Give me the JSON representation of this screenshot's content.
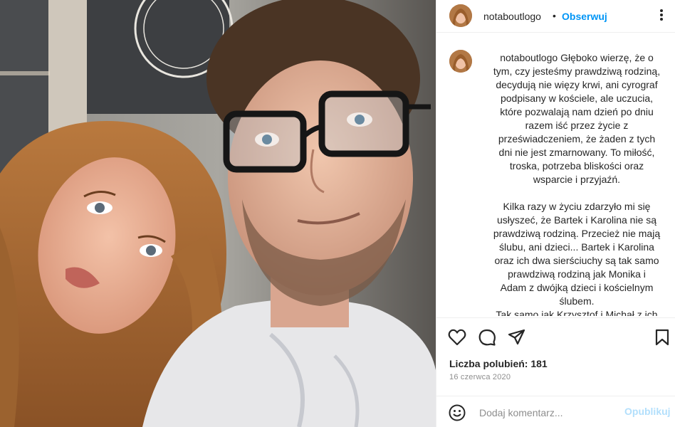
{
  "post": {
    "username": "notaboutlogo",
    "separator": "•",
    "follow_label": "Obserwuj",
    "caption_username": "notaboutlogo",
    "caption_lines": [
      "Głęboko wierzę, że o",
      "tym, czy jesteśmy prawdziwą rodziną,",
      "decydują nie więzy krwi, ani cyrograf",
      "podpisany w kościele, ale uczucia,",
      "które pozwalają nam dzień po dniu",
      "razem iść przez życie z",
      "przeświadczeniem, że żaden z tych",
      "dni nie jest zmarnowany. To miłość,",
      "troska, potrzeba bliskości oraz",
      "wsparcie i przyjaźń."
    ],
    "caption_lines_2": [
      "Kilka razy w życiu zdarzyło mi się",
      "usłyszeć, że Bartek i Karolina nie są",
      "prawdziwą rodziną. Przecież nie mają",
      "ślubu, ani dzieci... Bartek i Karolina",
      "oraz ich dwa sierściuchy są tak samo",
      "prawdziwą rodziną jak Monika i",
      "Adam z dwójką dzieci i kościelnym",
      "ślubem.",
      "Tak samo jak Krzysztof i Michał z ich"
    ],
    "likes_text": "Liczba polubień: 181",
    "date_text": "16 czerwca 2020"
  },
  "comment": {
    "placeholder": "Dodaj komentarz...",
    "post_label": "Opublikuj"
  },
  "icons": {
    "more": "more-options-icon",
    "like": "heart-icon",
    "comment": "comment-bubble-icon",
    "share": "paper-plane-icon",
    "save": "bookmark-icon",
    "emoji": "emoji-smile-icon"
  },
  "colors": {
    "accent": "#0095f6",
    "post_disabled": "#b2dffc",
    "text": "#262626",
    "muted": "#8e8e8e"
  }
}
